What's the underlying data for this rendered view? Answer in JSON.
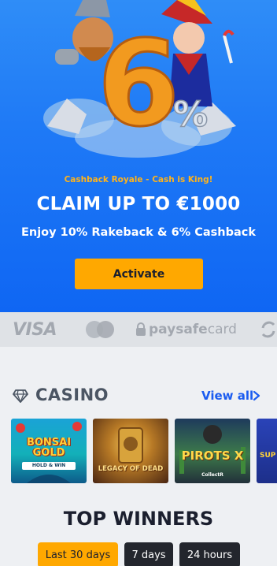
{
  "hero": {
    "subtitle": "Cashback Royale - Cash is King!",
    "title": "CLAIM UP TO €1000",
    "description": "Enjoy 10% Rakeback & 6% Cashback",
    "button_label": "Activate",
    "art": {
      "big_number": "6",
      "percent_sign": "%"
    }
  },
  "payments": {
    "visa": "VISA",
    "paysafecard_bold": "paysafe",
    "paysafecard_light": "card",
    "icons": [
      "visa-logo",
      "mastercard-icon",
      "paysafecard-logo",
      "more-payments-icon"
    ]
  },
  "casino": {
    "title": "CASINO",
    "view_all": "View all",
    "games": [
      {
        "name": "BONSAI GOLD",
        "sub": "HOLD & WIN"
      },
      {
        "name": "LEGACY OF DEAD"
      },
      {
        "name": "PIROTS X",
        "sub": "CollectR"
      },
      {
        "name": "SUP"
      }
    ]
  },
  "winners": {
    "title": "TOP WINNERS",
    "tabs": [
      "Last 30 days",
      "7 days",
      "24 hours"
    ],
    "active_tab": "Last 30 days"
  },
  "colors": {
    "hero_blue": "#1f7af6",
    "accent_orange": "#ffa800",
    "link_blue": "#1a5cf0",
    "dark_tab": "#23262d"
  }
}
